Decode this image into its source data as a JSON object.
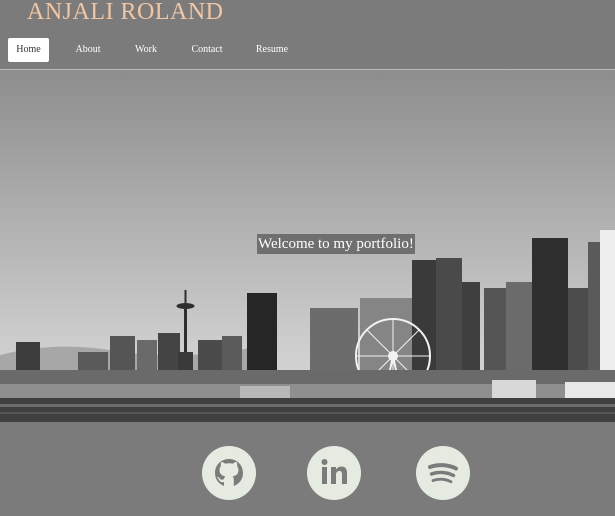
{
  "site": {
    "title": "ANJALI ROLAND"
  },
  "nav": {
    "items": [
      {
        "label": "Home",
        "active": true
      },
      {
        "label": "About",
        "active": false
      },
      {
        "label": "Work",
        "active": false
      },
      {
        "label": "Contact",
        "active": false
      },
      {
        "label": "Resume",
        "active": false
      }
    ]
  },
  "hero": {
    "welcome_text": "Welcome to my portfolio!",
    "image": "black-and-white-city-skyline"
  },
  "social": {
    "icons": [
      "github-icon",
      "linkedin-icon",
      "spotify-icon"
    ]
  },
  "colors": {
    "background": "#7b7b7b",
    "title": "#f2c6a3",
    "active_nav_bg": "#ffffff",
    "icon_fill": "#e6ebe2"
  }
}
